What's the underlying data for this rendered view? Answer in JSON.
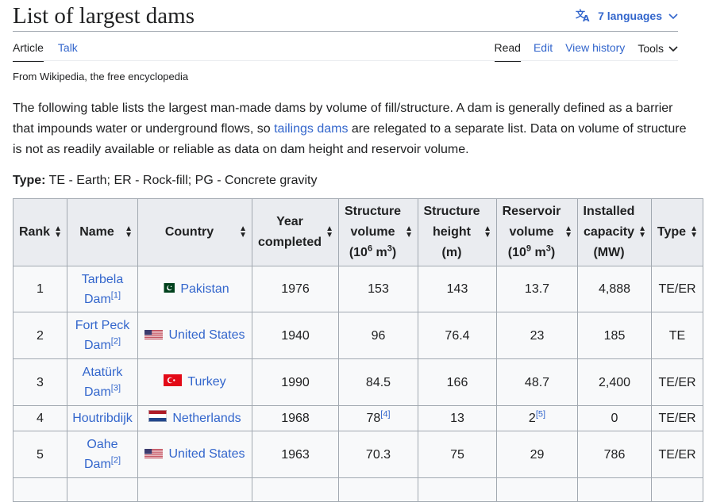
{
  "page": {
    "title": "List of largest dams",
    "languages": "7 languages",
    "tabs_left": [
      "Article",
      "Talk"
    ],
    "tabs_right": [
      "Read",
      "Edit",
      "View history"
    ],
    "tools": "Tools",
    "tagline": "From Wikipedia, the free encyclopedia"
  },
  "intro": {
    "before": "The following table lists the largest man-made dams by volume of fill/structure. A dam is generally defined as a barrier that impounds water or underground flows, so ",
    "link": "tailings dams",
    "after": " are relegated to a separate list. Data on volume of structure is not as readily available or reliable as data on dam height and reservoir volume."
  },
  "type_line": {
    "label": "Type:",
    "text": " TE - Earth; ER - Rock-fill; PG - Concrete gravity"
  },
  "table": {
    "headers": {
      "rank": "Rank",
      "name": "Name",
      "country": "Country",
      "year_1": "Year",
      "year_2": "completed",
      "svol_1": "Structure",
      "svol_2": "volume",
      "svol_3": "(10",
      "svol_3_sup": "6",
      "svol_3_mid": " m",
      "svol_3_sup2": "3",
      "svol_3_end": ")",
      "sh_1": "Structure",
      "sh_2": "height",
      "sh_3": "(m)",
      "rv_1": "Reservoir",
      "rv_2": "volume",
      "rv_3": "(10",
      "rv_3_sup": "9",
      "rv_3_mid": " m",
      "rv_3_sup2": "3",
      "rv_3_end": ")",
      "ic_1": "Installed",
      "ic_2": "capacity",
      "ic_3": "(MW)",
      "type": "Type"
    },
    "rows": [
      {
        "rank": "1",
        "name_1": "Tarbela",
        "name_2": "Dam",
        "ref": "[1]",
        "country": "Pakistan",
        "year": "1976",
        "volume": "153",
        "volume_ref": "",
        "height": "143",
        "reservoir": "13.7",
        "reservoir_ref": "",
        "capacity": "4,888",
        "type": "TE/ER"
      },
      {
        "rank": "2",
        "name_1": "Fort Peck",
        "name_2": "Dam",
        "ref": "[2]",
        "country": "United States",
        "year": "1940",
        "volume": "96",
        "volume_ref": "",
        "height": "76.4",
        "reservoir": "23",
        "reservoir_ref": "",
        "capacity": "185",
        "type": "TE"
      },
      {
        "rank": "3",
        "name_1": "Atatürk",
        "name_2": "Dam",
        "ref": "[3]",
        "country": "Turkey",
        "year": "1990",
        "volume": "84.5",
        "volume_ref": "",
        "height": "166",
        "reservoir": "48.7",
        "reservoir_ref": "",
        "capacity": "2,400",
        "type": "TE/ER"
      },
      {
        "rank": "4",
        "name_1": "Houtribdijk",
        "name_2": "",
        "ref": "",
        "country": "Netherlands",
        "year": "1968",
        "volume": "78",
        "volume_ref": "[4]",
        "height": "13",
        "reservoir": "2",
        "reservoir_ref": "[5]",
        "capacity": "0",
        "type": "TE/ER"
      },
      {
        "rank": "5",
        "name_1": "Oahe",
        "name_2": "Dam",
        "ref": "[2]",
        "country": "United States",
        "year": "1963",
        "volume": "70.3",
        "volume_ref": "",
        "height": "75",
        "reservoir": "29",
        "reservoir_ref": "",
        "capacity": "786",
        "type": "TE/ER"
      }
    ]
  },
  "colors": {
    "link": "#3366cc",
    "header_bg": "#eaecf0",
    "cell_bg": "#f8f9fa",
    "border": "#a2a9b1"
  }
}
